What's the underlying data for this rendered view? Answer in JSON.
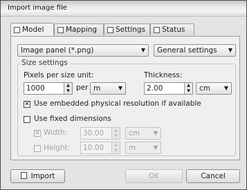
{
  "window": {
    "title": "Import image file"
  },
  "tabs": [
    {
      "label": "Model",
      "icon": "model-icon"
    },
    {
      "label": "Mapping",
      "icon": "mapping-icon"
    },
    {
      "label": "Settings",
      "icon": "settings-icon"
    },
    {
      "label": "Status",
      "icon": "status-icon"
    }
  ],
  "model": {
    "source_type": "Image panel (*.png)",
    "settings_mode": "General settings"
  },
  "size_settings": {
    "group_title": "Size settings",
    "pixels_label": "Pixels per size unit:",
    "pixels_value": "1000",
    "per_label": "per",
    "unit": "m",
    "thickness_label": "Thickness:",
    "thickness_value": "2.00",
    "thickness_unit": "cm",
    "embedded_checkbox_label": "Use embedded physical resolution if available",
    "embedded_checked": "✕",
    "fixed_checkbox_label": "Use fixed dimensions",
    "width_label": "Width:",
    "width_checked": "✕",
    "width_value": "30.00",
    "width_unit": "cm",
    "height_label": "Height:",
    "height_value": "10.00",
    "height_unit": "m"
  },
  "buttons": {
    "import": "Import",
    "ok": "OK",
    "cancel": "Cancel"
  }
}
